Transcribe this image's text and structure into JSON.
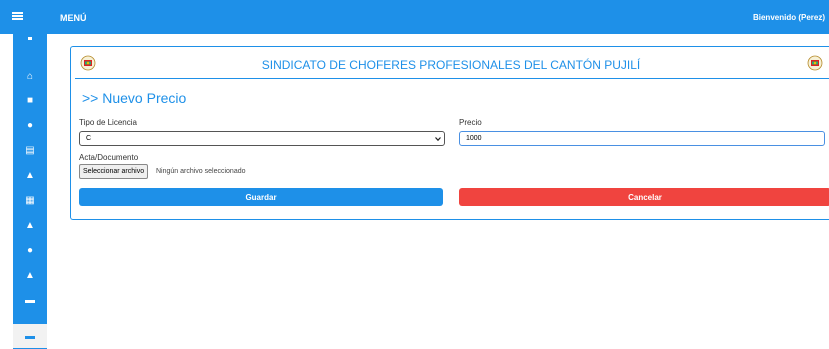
{
  "topbar": {
    "menu_label": "MENÚ",
    "welcome": "Bienvenido (Perez)"
  },
  "sidebar": {
    "items": [
      {
        "icon": "home-icon",
        "glyph": "🏠"
      },
      {
        "icon": "folder-icon",
        "glyph": "▰"
      },
      {
        "icon": "user-icon",
        "glyph": "👤"
      },
      {
        "icon": "id-card-icon",
        "glyph": "▤"
      },
      {
        "icon": "user-badge-icon",
        "glyph": "👤"
      },
      {
        "icon": "documents-icon",
        "glyph": "▦"
      },
      {
        "icon": "user-tie-icon",
        "glyph": "👤"
      },
      {
        "icon": "clock-icon",
        "glyph": "●"
      },
      {
        "icon": "users-icon",
        "glyph": "👥"
      },
      {
        "icon": "money-icon",
        "glyph": "▭"
      },
      {
        "icon": "card-icon",
        "glyph": "▭"
      }
    ]
  },
  "header": {
    "title": "SINDICATO DE CHOFERES PROFESIONALES DEL CANTÓN PUJILÍ"
  },
  "page": {
    "heading": ">> Nuevo Precio"
  },
  "form": {
    "license_label": "Tipo de Licencia",
    "license_value": "C",
    "price_label": "Precio",
    "price_value": "1000",
    "document_label": "Acta/Documento",
    "file_button": "Seleccionar archivo",
    "file_status": "Ningún archivo seleccionado",
    "save_label": "Guardar",
    "cancel_label": "Cancelar"
  },
  "colors": {
    "primary": "#1e90e8",
    "danger": "#f0443f"
  }
}
